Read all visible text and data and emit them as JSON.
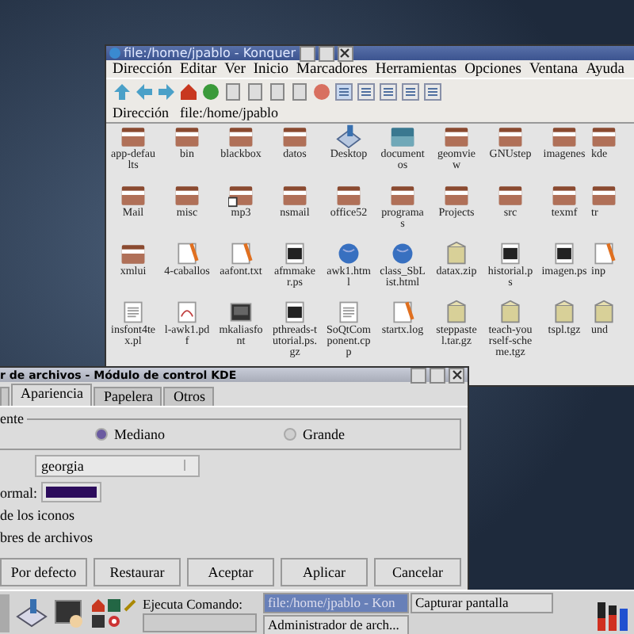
{
  "konqueror": {
    "title": "file:/home/jpablo - Konquer",
    "menu": [
      "Dirección",
      "Editar",
      "Ver",
      "Inicio",
      "Marcadores",
      "Herramientas",
      "Opciones",
      "Ventana",
      "Ayuda"
    ],
    "location_label": "Dirección",
    "location": "file:/home/jpablo",
    "files": [
      {
        "name": "app-defaults",
        "kind": "folder"
      },
      {
        "name": "bin",
        "kind": "folder"
      },
      {
        "name": "blackbox",
        "kind": "folder"
      },
      {
        "name": "datos",
        "kind": "folder"
      },
      {
        "name": "Desktop",
        "kind": "desktop"
      },
      {
        "name": "documentos",
        "kind": "docfolder"
      },
      {
        "name": "geomview",
        "kind": "folder"
      },
      {
        "name": "GNUstep",
        "kind": "folder"
      },
      {
        "name": "imagenes",
        "kind": "folder"
      },
      {
        "name": "kde",
        "kind": "folder"
      },
      {
        "name": "Mail",
        "kind": "folder"
      },
      {
        "name": "misc",
        "kind": "folder"
      },
      {
        "name": "mp3",
        "kind": "link"
      },
      {
        "name": "nsmail",
        "kind": "folder"
      },
      {
        "name": "office52",
        "kind": "folder"
      },
      {
        "name": "programas",
        "kind": "folder"
      },
      {
        "name": "Projects",
        "kind": "folder"
      },
      {
        "name": "src",
        "kind": "folder"
      },
      {
        "name": "texmf",
        "kind": "folder"
      },
      {
        "name": "tr",
        "kind": "folder"
      },
      {
        "name": "xmlui",
        "kind": "folder"
      },
      {
        "name": "4-caballos",
        "kind": "text"
      },
      {
        "name": "aafont.txt",
        "kind": "text"
      },
      {
        "name": "afmmaker.ps",
        "kind": "ps"
      },
      {
        "name": "awk1.html",
        "kind": "web"
      },
      {
        "name": "class_SbList.html",
        "kind": "web"
      },
      {
        "name": "datax.zip",
        "kind": "archive"
      },
      {
        "name": "historial.ps",
        "kind": "ps"
      },
      {
        "name": "imagen.ps",
        "kind": "ps"
      },
      {
        "name": "inp",
        "kind": "text"
      },
      {
        "name": "insfont4tex.pl",
        "kind": "doc"
      },
      {
        "name": "l-awk1.pdf",
        "kind": "pdf"
      },
      {
        "name": "mkaliasfont",
        "kind": "exec"
      },
      {
        "name": "pthreads-tutorial.ps.gz",
        "kind": "ps"
      },
      {
        "name": "SoQtComponent.cpp",
        "kind": "doc"
      },
      {
        "name": "startx.log",
        "kind": "text"
      },
      {
        "name": "steppastel.tar.gz",
        "kind": "archive"
      },
      {
        "name": "teach-yourself-scheme.tgz",
        "kind": "archive"
      },
      {
        "name": "tspl.tgz",
        "kind": "archive"
      },
      {
        "name": "und",
        "kind": "archive"
      }
    ]
  },
  "dialog": {
    "title": "r de archivos - Módulo de control KDE",
    "tabs": [
      {
        "label": "Apariencia",
        "selected": true
      },
      {
        "label": "Papelera",
        "selected": false
      },
      {
        "label": "Otros",
        "selected": false
      }
    ],
    "group_label": "ente",
    "sizes": [
      {
        "label": "Mediano",
        "selected": true
      },
      {
        "label": "Grande",
        "selected": false
      }
    ],
    "font_value": "georgia",
    "color_label": "ormal:",
    "color": "#2c0c5c",
    "options": [
      "de los iconos",
      "bres de archivos"
    ],
    "buttons": [
      "Por defecto",
      "Restaurar",
      "Aceptar",
      "Aplicar",
      "Cancelar"
    ]
  },
  "taskbar": {
    "run_label": "Ejecuta Comando:",
    "tasks": [
      {
        "label": "file:/home/jpablo - Kon",
        "selected": true
      },
      {
        "label": "Capturar pantalla",
        "selected": false
      },
      {
        "label": "Administrador de arch...",
        "selected": false
      }
    ]
  }
}
